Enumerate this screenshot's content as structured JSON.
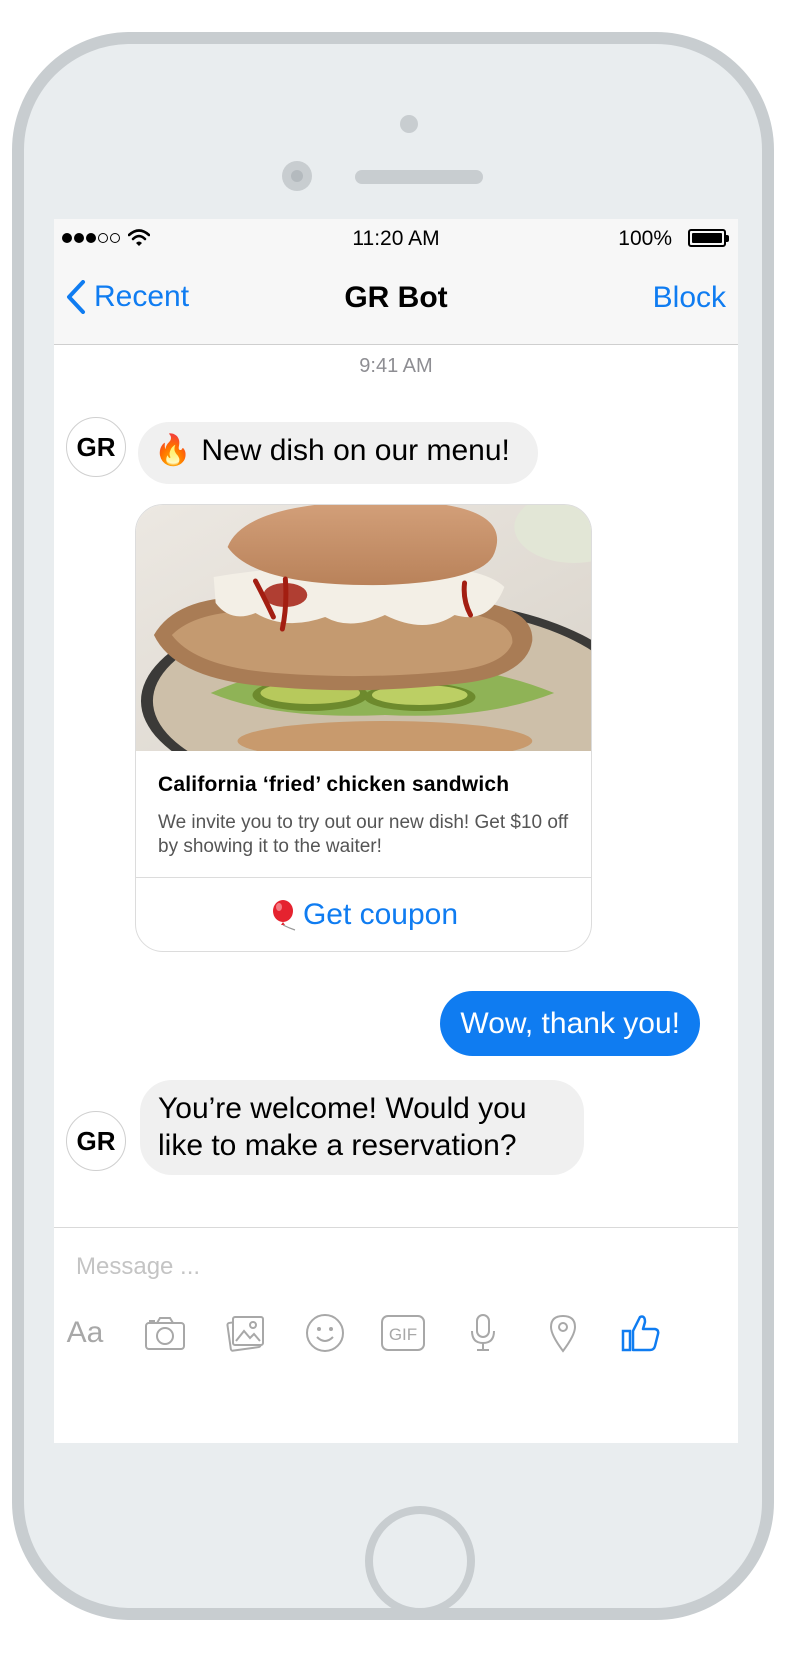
{
  "status_bar": {
    "time": "11:20 AM",
    "battery": "100%",
    "signal_dots_filled": 3,
    "signal_dots_total": 5
  },
  "nav": {
    "back_label": "Recent",
    "title": "GR Bot",
    "action_label": "Block"
  },
  "conversation": {
    "timestamp": "9:41 AM",
    "bot_avatar": "GR",
    "messages": [
      {
        "from": "bot",
        "emoji": "🔥",
        "text": "New dish on our menu!"
      },
      {
        "from": "bot",
        "type": "card",
        "title": "California ‘fried’ chicken sandwich",
        "description": "We invite you to try out our new dish! Get $10 off by showing it to the waiter!",
        "button_label": "Get coupon",
        "button_icon": "balloon-icon"
      },
      {
        "from": "user",
        "text": "Wow, thank you!"
      },
      {
        "from": "bot",
        "text": "You’re welcome! Would you like to make a reservation?"
      }
    ]
  },
  "composer": {
    "placeholder": "Message ...",
    "value": "",
    "tools": [
      "text-format-icon",
      "camera-icon",
      "gallery-icon",
      "emoji-icon",
      "gif-icon",
      "microphone-icon",
      "location-icon",
      "like-icon"
    ],
    "aa_label": "Aa",
    "gif_label": "GIF"
  },
  "colors": {
    "accent": "#0f7cf1",
    "incoming_bubble": "#f0f0f0",
    "phone_body": "#e9edef",
    "phone_border": "#c8cdd0"
  }
}
